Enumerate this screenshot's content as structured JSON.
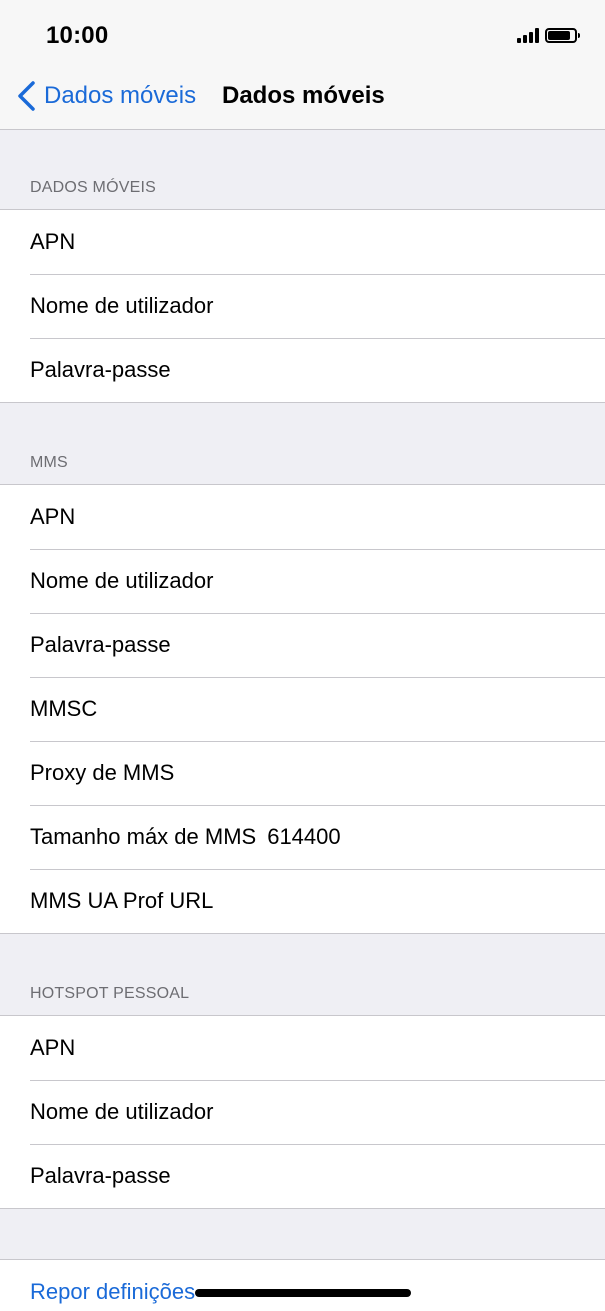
{
  "status_bar": {
    "time": "10:00",
    "signal_bars": 4,
    "battery_level": 0.9
  },
  "nav": {
    "back_label": "Dados móveis",
    "title": "Dados móveis"
  },
  "sections": [
    {
      "header": "DADOS MÓVEIS",
      "rows": [
        {
          "label": "APN",
          "value": ""
        },
        {
          "label": "Nome de utilizador",
          "value": ""
        },
        {
          "label": "Palavra-passe",
          "value": ""
        }
      ]
    },
    {
      "header": "MMS",
      "rows": [
        {
          "label": "APN",
          "value": ""
        },
        {
          "label": "Nome de utilizador",
          "value": ""
        },
        {
          "label": "Palavra-passe",
          "value": ""
        },
        {
          "label": "MMSC",
          "value": ""
        },
        {
          "label": "Proxy de MMS",
          "value": ""
        },
        {
          "label": "Tamanho máx de MMS",
          "value": "614400"
        },
        {
          "label": "MMS UA Prof URL",
          "value": ""
        }
      ]
    },
    {
      "header": "HOTSPOT PESSOAL",
      "rows": [
        {
          "label": "APN",
          "value": ""
        },
        {
          "label": "Nome de utilizador",
          "value": ""
        },
        {
          "label": "Palavra-passe",
          "value": ""
        }
      ]
    }
  ],
  "reset": {
    "label": "Repor definições"
  },
  "colors": {
    "accent": "#1a6ad8",
    "background": "#efeff4",
    "separator": "#c8c7cc"
  }
}
